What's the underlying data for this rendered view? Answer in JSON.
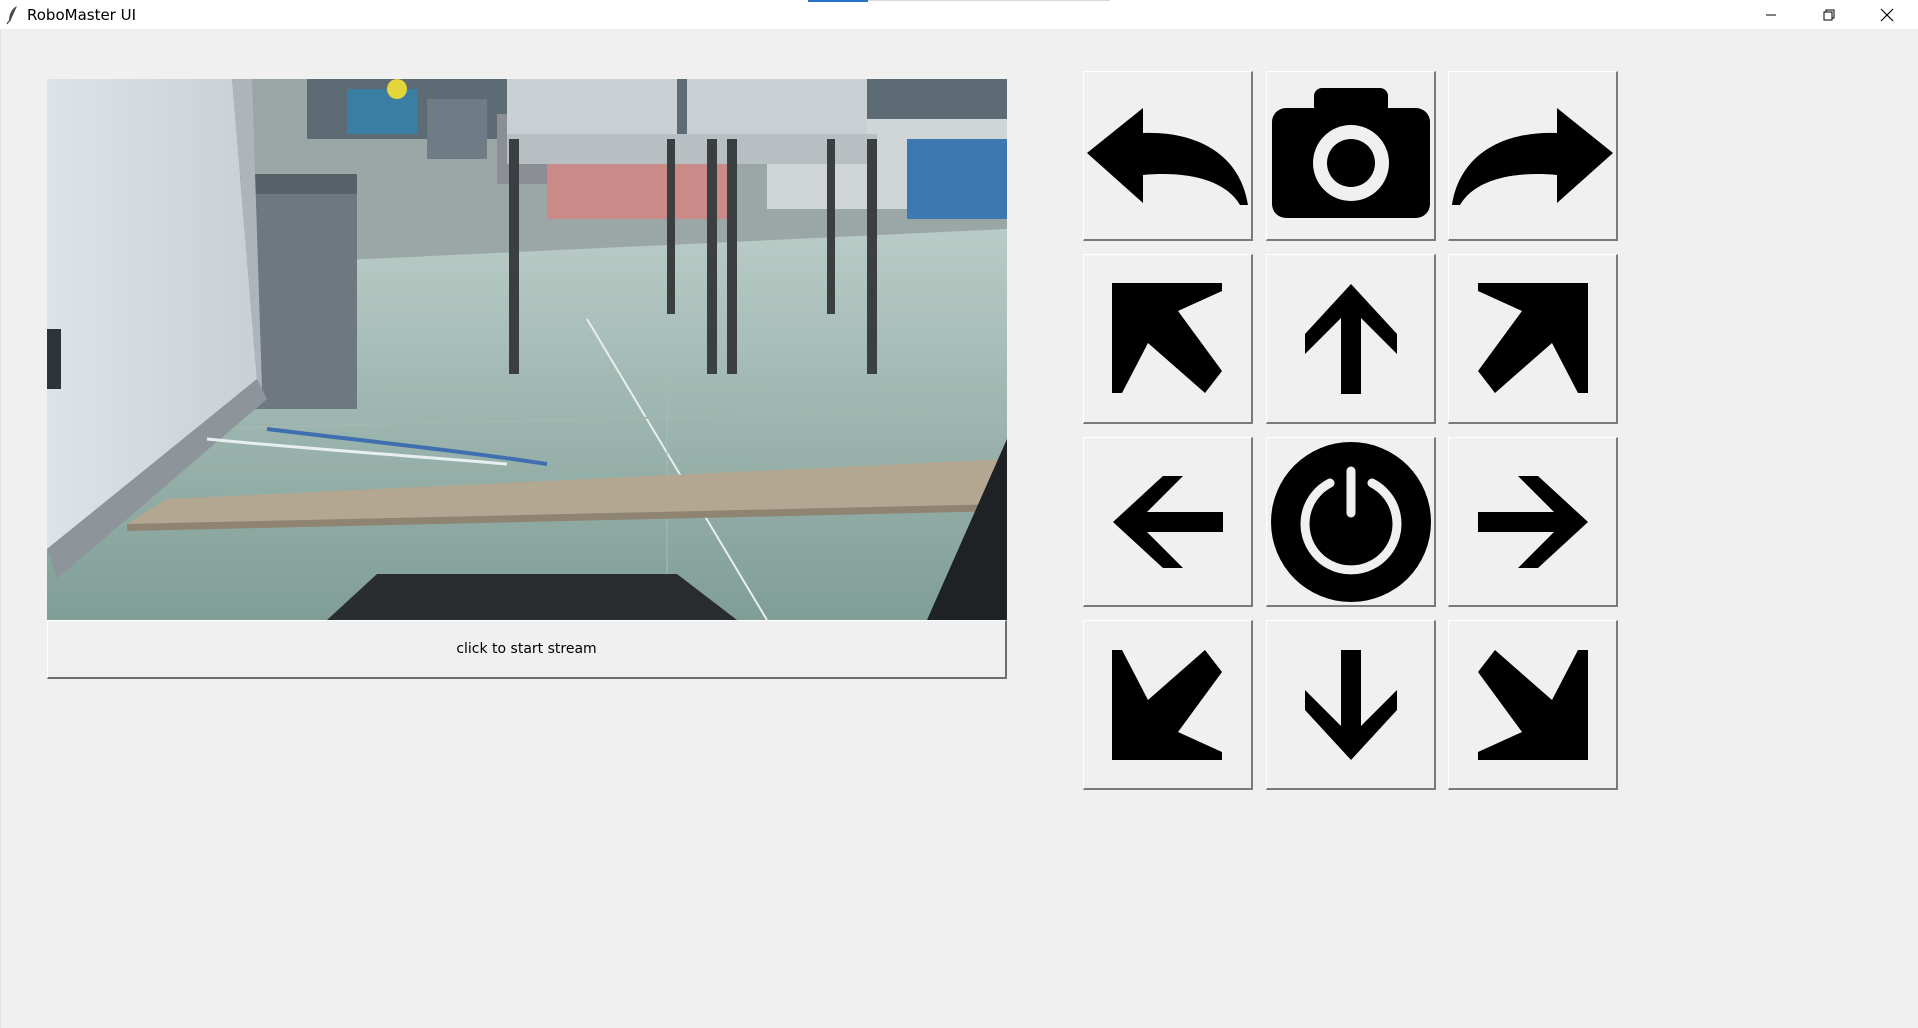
{
  "window": {
    "title": "RoboMaster UI",
    "icon": "feather-icon"
  },
  "window_controls": [
    {
      "name": "minimize-icon"
    },
    {
      "name": "restore-icon"
    },
    {
      "name": "close-icon"
    }
  ],
  "video": {
    "stream_button_label": "click to start stream"
  },
  "controls": [
    {
      "name": "turn-left-button",
      "icon": "curved-arrow-left-icon"
    },
    {
      "name": "capture-photo-button",
      "icon": "camera-icon"
    },
    {
      "name": "turn-right-button",
      "icon": "curved-arrow-right-icon"
    },
    {
      "name": "move-forward-left-button",
      "icon": "arrow-up-left-icon"
    },
    {
      "name": "move-forward-button",
      "icon": "arrow-up-icon"
    },
    {
      "name": "move-forward-right-button",
      "icon": "arrow-up-right-icon"
    },
    {
      "name": "move-left-button",
      "icon": "arrow-left-icon"
    },
    {
      "name": "power-button",
      "icon": "power-icon"
    },
    {
      "name": "move-right-button",
      "icon": "arrow-right-icon"
    },
    {
      "name": "move-back-left-button",
      "icon": "arrow-down-left-icon"
    },
    {
      "name": "move-back-button",
      "icon": "arrow-down-icon"
    },
    {
      "name": "move-back-right-button",
      "icon": "arrow-down-right-icon"
    }
  ],
  "colors": {
    "background": "#f0f0f0",
    "icon": "#000000",
    "titlebar": "#ffffff"
  }
}
